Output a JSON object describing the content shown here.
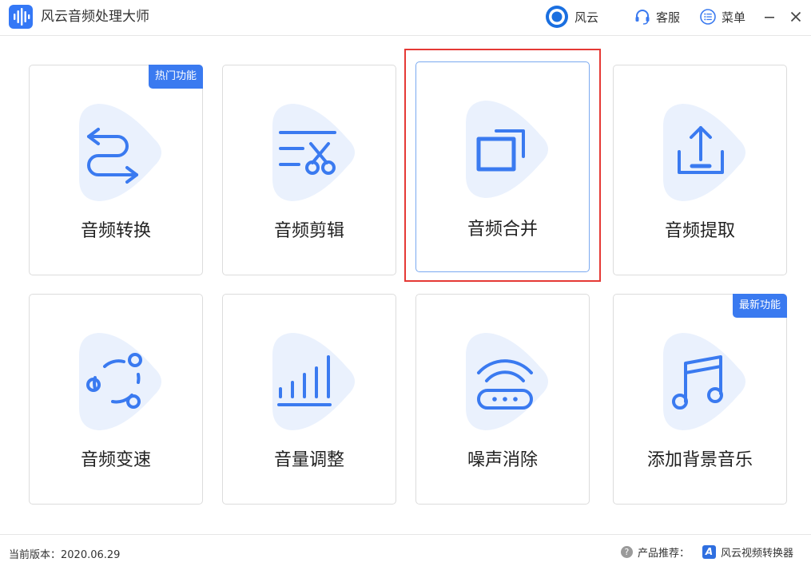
{
  "app": {
    "title": "风云音频处理大师"
  },
  "header": {
    "brand_label": "风云",
    "service_label": "客服",
    "menu_label": "菜单"
  },
  "cards": [
    {
      "label": "音频转换",
      "badge": "热门功能"
    },
    {
      "label": "音频剪辑",
      "badge": ""
    },
    {
      "label": "音频合并",
      "badge": ""
    },
    {
      "label": "音频提取",
      "badge": ""
    },
    {
      "label": "音频变速",
      "badge": ""
    },
    {
      "label": "音量调整",
      "badge": ""
    },
    {
      "label": "噪声消除",
      "badge": ""
    },
    {
      "label": "添加背景音乐",
      "badge": "最新功能"
    }
  ],
  "footer": {
    "version": "当前版本：2020.06.29",
    "recommend_label": "产品推荐：",
    "product_name": "风云视频转换器"
  },
  "colors": {
    "accent": "#3a7af0",
    "icon_bg": "#eaf1fd",
    "highlight": "#e53935"
  }
}
